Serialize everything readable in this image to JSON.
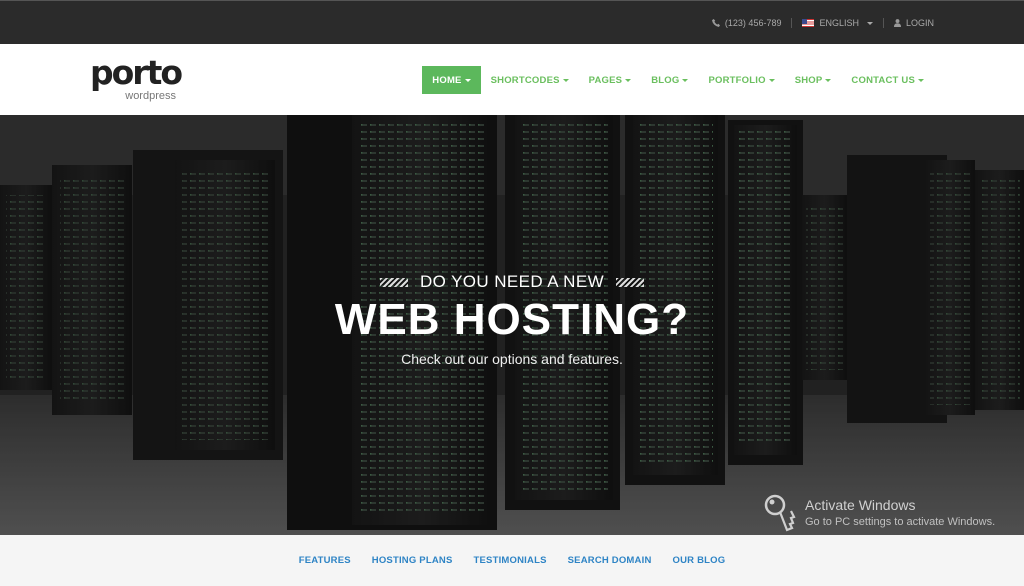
{
  "topbar": {
    "phone": "(123) 456-789",
    "language": "ENGLISH",
    "login": "LOGIN"
  },
  "header": {
    "logo_word": "porto",
    "logo_sub": "wordpress",
    "nav": [
      {
        "label": "HOME",
        "active": true
      },
      {
        "label": "SHORTCODES",
        "active": false
      },
      {
        "label": "PAGES",
        "active": false
      },
      {
        "label": "BLOG",
        "active": false
      },
      {
        "label": "PORTFOLIO",
        "active": false
      },
      {
        "label": "SHOP",
        "active": false
      },
      {
        "label": "CONTACT US",
        "active": false
      }
    ]
  },
  "hero": {
    "pre_title": "DO YOU NEED A NEW",
    "title": "WEB HOSTING?",
    "subtitle": "Check out our options and features."
  },
  "watermark": {
    "title": "Activate Windows",
    "text": "Go to PC settings to activate Windows."
  },
  "subnav": [
    "FEATURES",
    "HOSTING PLANS",
    "TESTIMONIALS",
    "SEARCH DOMAIN",
    "OUR BLOG"
  ],
  "colors": {
    "accent_green": "#5cb85c",
    "nav_green": "#6abf5e",
    "subnav_blue": "#2e84c5",
    "topbar_bg": "#2b2b2b"
  }
}
